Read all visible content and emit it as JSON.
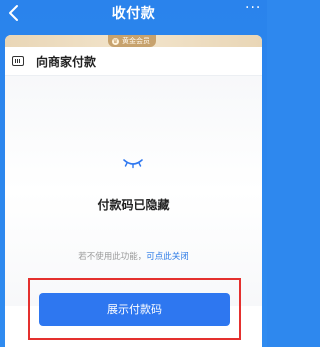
{
  "nav": {
    "title": "收付款",
    "more_label": "···"
  },
  "vip": {
    "label": "黄金会员"
  },
  "merchant": {
    "label": "向商家付款"
  },
  "hidden_state": {
    "title": "付款码已隐藏",
    "hint_prefix": "若不使用此功能，",
    "hint_link": "可点此关闭"
  },
  "actions": {
    "show_button_label": "展示付款码"
  },
  "colors": {
    "header_blue": "#2a83ec",
    "button_blue": "#2e77f0",
    "link_blue": "#2a79e6",
    "highlight_red": "#e4302e",
    "vip_gold": "#c7a26d"
  },
  "icons": {
    "back": "back-icon",
    "more": "more-icon",
    "barcode": "barcode-icon",
    "closed_eye": "closed-eye-icon",
    "crown": "crown-icon"
  }
}
